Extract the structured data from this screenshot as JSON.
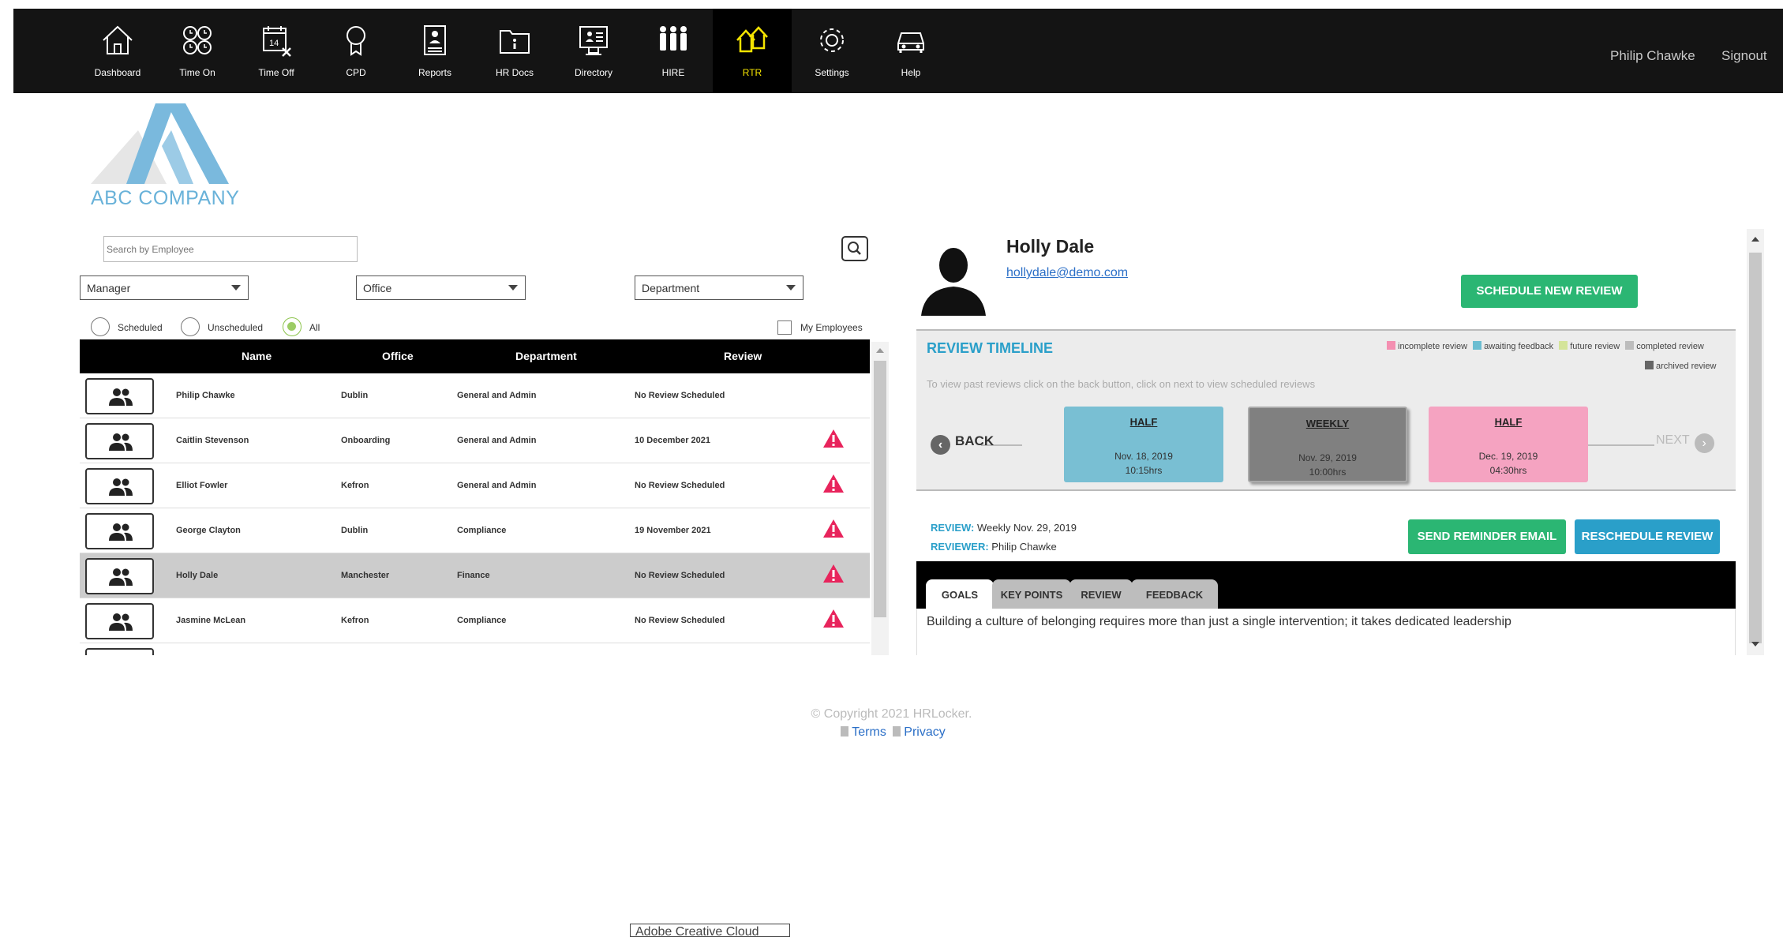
{
  "nav": {
    "items": [
      {
        "label": "Dashboard",
        "icon": "home-icon"
      },
      {
        "label": "Time On",
        "icon": "time-on-icon"
      },
      {
        "label": "Time Off",
        "icon": "calendar-icon"
      },
      {
        "label": "CPD",
        "icon": "award-icon"
      },
      {
        "label": "Reports",
        "icon": "reports-icon"
      },
      {
        "label": "HR Docs",
        "icon": "folder-icon"
      },
      {
        "label": "Directory",
        "icon": "directory-icon"
      },
      {
        "label": "HIRE",
        "icon": "hire-icon"
      },
      {
        "label": "RTR",
        "icon": "rtr-icon",
        "active": true
      },
      {
        "label": "Settings",
        "icon": "gear-icon"
      },
      {
        "label": "Help",
        "icon": "car-icon"
      }
    ],
    "user": "Philip Chawke",
    "signout": "Signout",
    "active_color": "#f5e400"
  },
  "logo": {
    "text": "ABC COMPANY",
    "color": "#69b2d9"
  },
  "filters": {
    "search_placeholder": "Search by Employee",
    "manager": "Manager",
    "office": "Office",
    "department": "Department",
    "radios": [
      {
        "label": "Scheduled",
        "checked": false
      },
      {
        "label": "Unscheduled",
        "checked": false
      },
      {
        "label": "All",
        "checked": true
      }
    ],
    "my_employees": "My Employees"
  },
  "table": {
    "headers": [
      "Name",
      "Office",
      "Department",
      "Review"
    ],
    "rows": [
      {
        "name": "Philip Chawke",
        "office": "Dublin",
        "department": "General and Admin",
        "review": "No Review Scheduled",
        "warning": false
      },
      {
        "name": "Caitlin Stevenson",
        "office": "Onboarding",
        "department": "General and Admin",
        "review": "10 December 2021",
        "warning": true
      },
      {
        "name": "Elliot Fowler",
        "office": "Kefron",
        "department": "General and Admin",
        "review": "No Review Scheduled",
        "warning": true
      },
      {
        "name": "George Clayton",
        "office": "Dublin",
        "department": "Compliance",
        "review": "19 November 2021",
        "warning": true
      },
      {
        "name": "Holly Dale",
        "office": "Manchester",
        "department": "Finance",
        "review": "No Review Scheduled",
        "warning": true,
        "selected": true
      },
      {
        "name": "Jasmine McLean",
        "office": "Kefron",
        "department": "Compliance",
        "review": "No Review Scheduled",
        "warning": true
      }
    ]
  },
  "profile": {
    "name": "Holly Dale",
    "email": "hollydale@demo.com",
    "schedule_button": "SCHEDULE NEW REVIEW"
  },
  "timeline": {
    "title": "REVIEW TIMELINE",
    "hint": "To view past reviews click on the back button, click on next to view scheduled reviews",
    "legend": [
      {
        "label": "incomplete review",
        "color": "#f48fb1"
      },
      {
        "label": "awaiting feedback",
        "color": "#6bbdd1"
      },
      {
        "label": "future review",
        "color": "#d4e49a"
      },
      {
        "label": "completed review",
        "color": "#bdbdbd"
      },
      {
        "label": "archived review",
        "color": "#666666"
      }
    ],
    "back": "BACK",
    "next": "NEXT",
    "cards": [
      {
        "type": "HALF",
        "date": "Nov. 18, 2019",
        "time": "10:15hrs",
        "color": "#79bfd3"
      },
      {
        "type": "WEEKLY",
        "date": "Nov. 29, 2019",
        "time": "10:00hrs",
        "color": "#808080"
      },
      {
        "type": "HALF",
        "date": "Dec. 19, 2019",
        "time": "04:30hrs",
        "color": "#f5a3c1"
      }
    ]
  },
  "review": {
    "review_label": "REVIEW:",
    "review_value": "Weekly Nov. 29, 2019",
    "reviewer_label": "REVIEWER:",
    "reviewer_value": "Philip Chawke",
    "send_reminder": "SEND REMINDER EMAIL",
    "reschedule": "RESCHEDULE REVIEW"
  },
  "tabs": {
    "items": [
      "GOALS",
      "KEY POINTS",
      "REVIEW",
      "FEEDBACK"
    ],
    "active": "GOALS",
    "content": "Building a culture of belonging requires more than just a single intervention; it takes dedicated leadership"
  },
  "footer": {
    "copyright": "© Copyright 2021 HRLocker.",
    "terms": "Terms",
    "privacy": "Privacy"
  },
  "tooltip": "Adobe Creative Cloud"
}
